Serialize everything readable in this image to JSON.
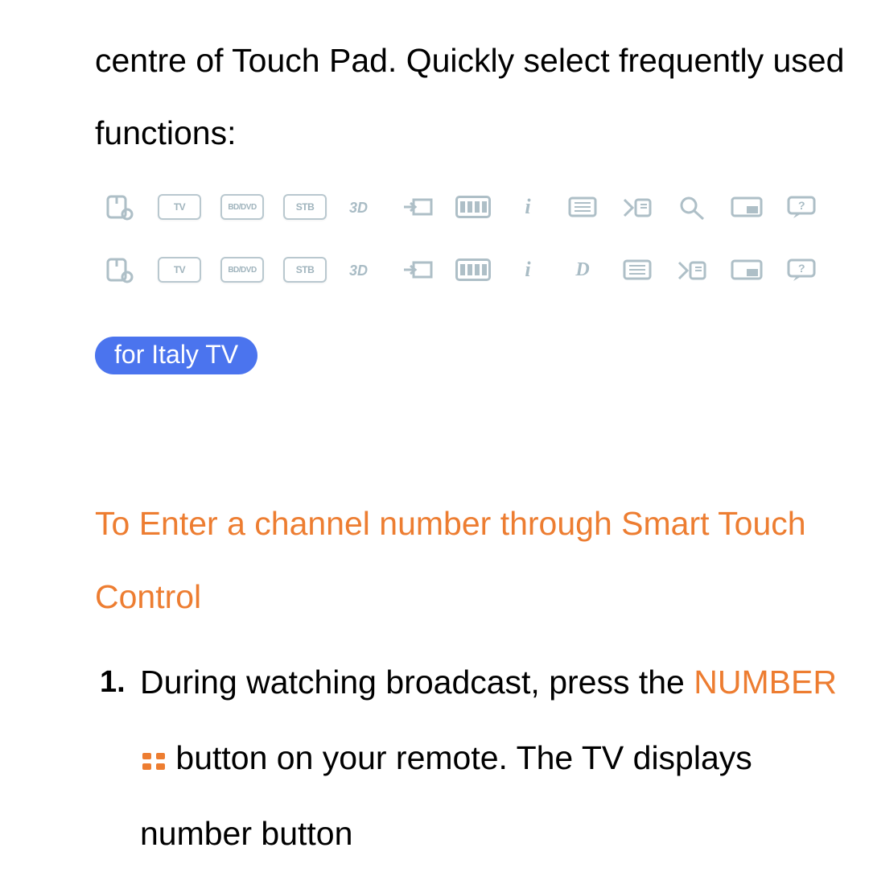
{
  "intro": "centre of Touch Pad. Quickly select frequently used functions:",
  "row1": {
    "labels": [
      "TV",
      "BD/DVD",
      "STB"
    ],
    "icons": [
      "power-settings",
      "tv",
      "bd-dvd",
      "stb",
      "3d",
      "source",
      "battery-bars",
      "info",
      "list",
      "sound-in",
      "search",
      "pip",
      "help"
    ]
  },
  "row2": {
    "labels": [
      "TV",
      "BD/DVD",
      "STB"
    ],
    "icons": [
      "power-settings",
      "tv",
      "bd-dvd",
      "stb",
      "3d",
      "source",
      "battery-bars",
      "info",
      "d-logo",
      "list",
      "sound-in",
      "pip",
      "help"
    ]
  },
  "badge": "for Italy TV",
  "heading2": "To Enter a channel number through Smart Touch Control",
  "step1_a": "During watching broadcast, press the",
  "step1_kw": "NUMBER",
  "step1_b": " button on your remote. The TV displays number button"
}
